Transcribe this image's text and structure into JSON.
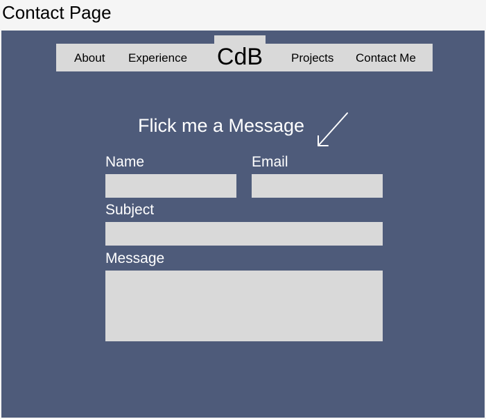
{
  "page_label": "Contact Page",
  "nav": {
    "logo": "CdB",
    "items": [
      {
        "label": "About"
      },
      {
        "label": "Experience"
      },
      {
        "label": "Projects"
      },
      {
        "label": "Contact Me"
      }
    ]
  },
  "form": {
    "heading": "Flick me a Message",
    "name_label": "Name",
    "name_value": "",
    "email_label": "Email",
    "email_value": "",
    "subject_label": "Subject",
    "subject_value": "",
    "message_label": "Message",
    "message_value": ""
  },
  "colors": {
    "page_background": "#f5f5f5",
    "frame_background": "#4e5b7a",
    "nav_background": "#d9d9d9",
    "field_background": "#d9d9d9",
    "form_text": "#ffffff"
  },
  "icons": {
    "heading_arrow": "arrow-down-left-icon"
  }
}
